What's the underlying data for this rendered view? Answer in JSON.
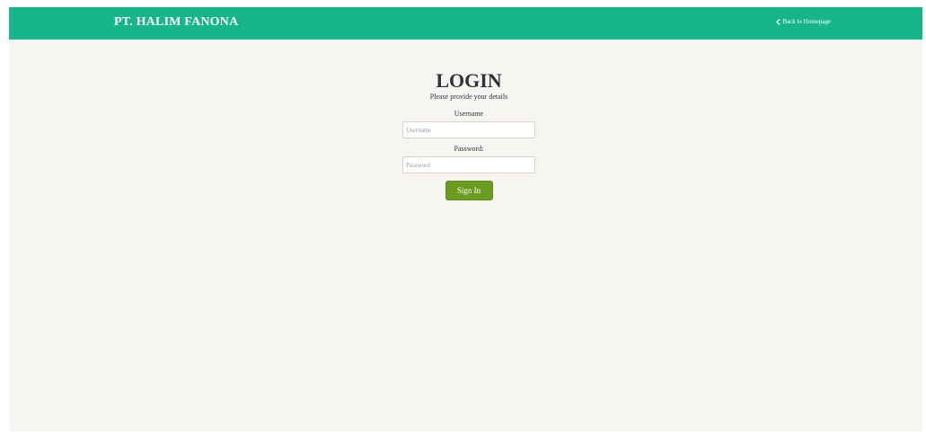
{
  "navbar": {
    "brand": "PT. HALIM FANONA",
    "back_link_label": "Back to Homepage",
    "back_icon": "chevron-left-icon"
  },
  "login": {
    "title": "LOGIN",
    "subtitle": "Please provide your details",
    "username_label": "Username",
    "username_placeholder": "Username",
    "username_value": "",
    "password_label": "Password:",
    "password_placeholder": "Password",
    "password_value": "",
    "signin_label": "Sign In"
  },
  "colors": {
    "navbar": "#17b58c",
    "background": "#f7f5f1",
    "button": "#6b9c1e",
    "text": "#333333"
  }
}
